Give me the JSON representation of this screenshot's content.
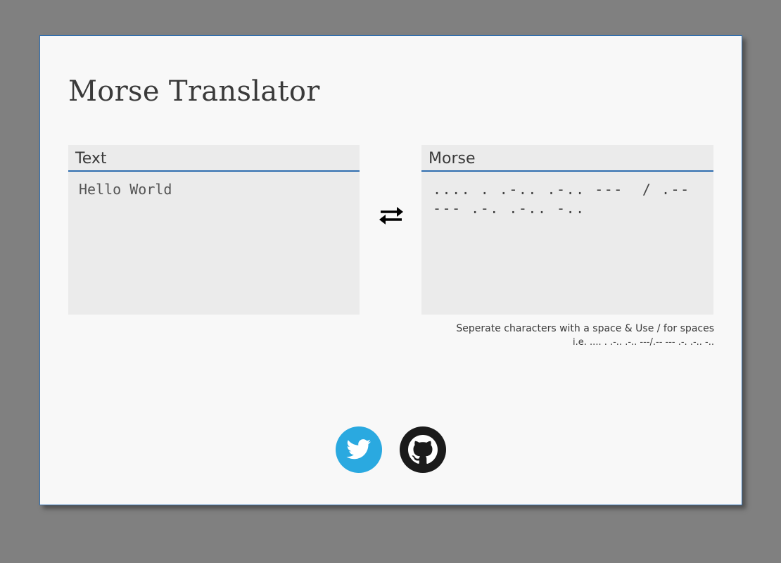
{
  "app": {
    "title": "Morse Translator"
  },
  "text_panel": {
    "label": "Text",
    "value": "Hello World"
  },
  "morse_panel": {
    "label": "Morse",
    "value": ".... . .-.. .-.. ---  / .-- --- .-. .-.. -.."
  },
  "swap": {
    "icon": "swap-arrows-icon"
  },
  "hint": {
    "line1": "Seperate characters with a space & Use / for spaces",
    "line2": "i.e. .... . .-.. .-.. ---/.-- --- .-. .-.. -.."
  },
  "social": {
    "twitter_icon": "twitter-icon",
    "github_icon": "github-icon"
  },
  "colors": {
    "accent": "#2f6eb0",
    "twitter": "#2aa9e0",
    "github": "#1b1b1b",
    "backdrop": "#808080",
    "card": "#f8f8f8"
  }
}
